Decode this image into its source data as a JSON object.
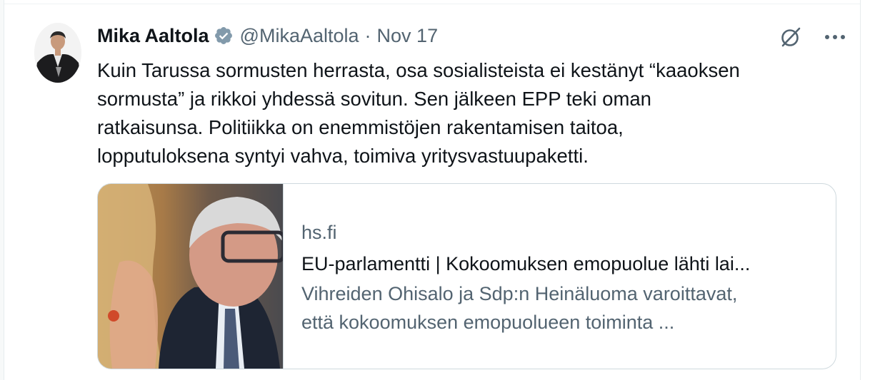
{
  "tweet": {
    "author_name": "Mika Aaltola",
    "handle": "@MikaAaltola",
    "separator": "·",
    "date": "Nov 17",
    "text_lines": [
      "Kuin Tarussa sormusten herrasta, osa sosialisteista ei kestänyt “kaaoksen",
      "sormusta” ja rikkoi yhdessä sovitun. Sen jälkeen EPP teki oman",
      "ratkaisunsa. Politiikka on enemmistöjen rakentamisen taitoa,",
      "lopputuloksena syntyi vahva, toimiva yritysvastuupaketti."
    ]
  },
  "actions": {
    "grok_icon": "grok-icon",
    "more_icon": "more-icon"
  },
  "card": {
    "domain": "hs.fi",
    "title": "EU-parlamentti | Kokoomuksen emopuolue lähti lai...",
    "description_lines": [
      "Vihreiden Ohisalo ja Sdp:n Heinäluoma varoittavat,",
      "että kokoomuksen emopuolueen toiminta ..."
    ]
  },
  "colors": {
    "text": "#0f1419",
    "secondary": "#536471",
    "border": "#cfd9de",
    "verified": "#829aab"
  }
}
